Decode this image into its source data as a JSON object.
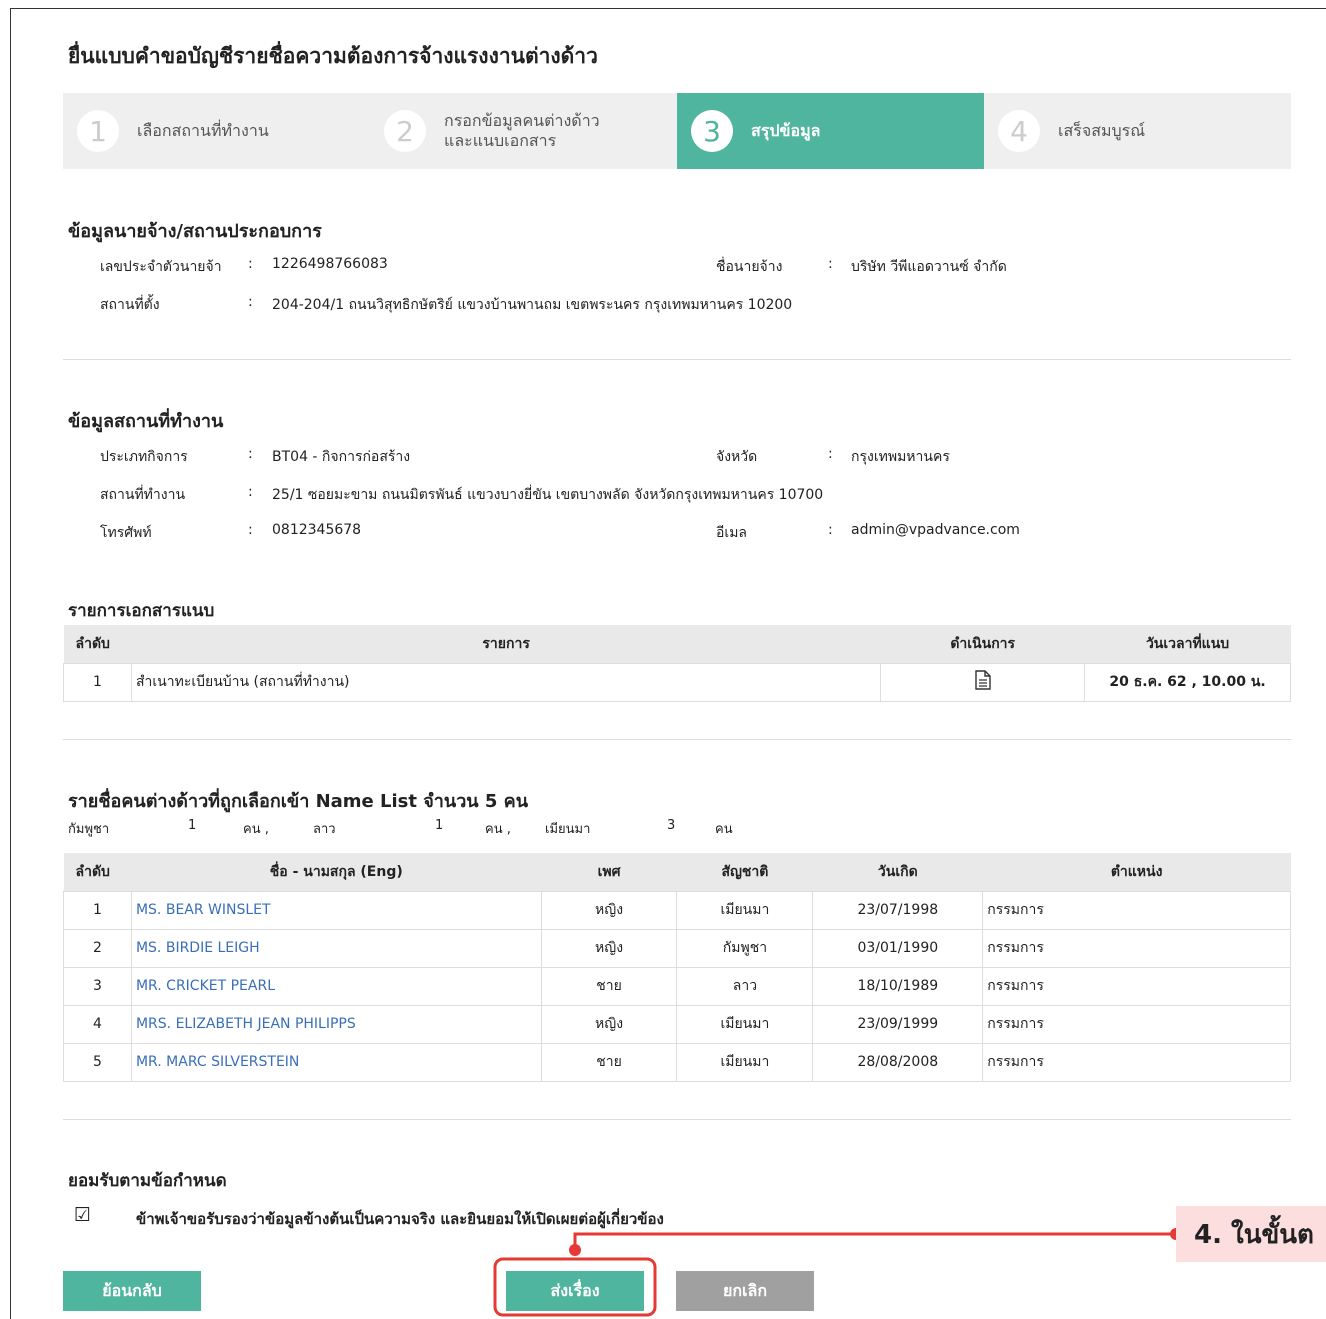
{
  "page_title": "ยื่นแบบคำขอบัญชีรายชื่อความต้องการจ้างแรงงานต่างด้าว",
  "steps": [
    {
      "num": "1",
      "label": "เลือกสถานที่ทำงาน"
    },
    {
      "num": "2",
      "label": "กรอกข้อมูลคนต่างด้าว\nและแนบเอกสาร"
    },
    {
      "num": "3",
      "label": "สรุปข้อมูล"
    },
    {
      "num": "4",
      "label": "เสร็จสมบูรณ์"
    }
  ],
  "employer": {
    "title": "ข้อมูลนายจ้าง/สถานประกอบการ",
    "id_label": "เลขประจำตัวนายจ้า",
    "id_value": "1226498766083",
    "name_label": "ชื่อนายจ้าง",
    "name_value": "บริษัท วีพีแอดวานซ์ จำกัด",
    "address_label": "สถานที่ตั้ง",
    "address_value": "204-204/1 ถนนวิสุทธิกษัตริย์ แขวงบ้านพานถม เขตพระนคร กรุงเทพมหานคร 10200"
  },
  "workplace": {
    "title": "ข้อมูลสถานที่ทำงาน",
    "business_label": "ประเภทกิจการ",
    "business_value": "BT04 - กิจการก่อสร้าง",
    "province_label": "จังหวัด",
    "province_value": "กรุงเทพมหานคร",
    "place_label": "สถานที่ทำงาน",
    "place_value": "25/1 ซอยมะขาม ถนนมิตรพันธ์ แขวงบางยี่ขัน เขตบางพลัด จังหวัดกรุงเทพมหานคร 10700",
    "phone_label": "โทรศัพท์",
    "phone_value": "0812345678",
    "email_label": "อีเมล",
    "email_value": "admin@vpadvance.com"
  },
  "colon": ":",
  "documents": {
    "title": "รายการเอกสารแนบ",
    "headers": [
      "ลำดับ",
      "รายการ",
      "ดำเนินการ",
      "วันเวลาที่แนบ"
    ],
    "rows": [
      {
        "no": "1",
        "name": "สำเนาทะเบียนบ้าน (สถานที่ทำงาน)",
        "date": "20 ธ.ค. 62 , 10.00 น."
      }
    ],
    "action_icon": "document-icon"
  },
  "namelist": {
    "title": "รายชื่อคนต่างด้าวที่ถูกเลือกเข้า Name List จำนวน 5 คน",
    "counts": [
      "กัมพูชา",
      "1",
      "คน ,",
      "ลาว",
      "1",
      "คน ,",
      "เมียนมา",
      "3",
      "คน"
    ],
    "headers": [
      "ลำดับ",
      "ชื่อ - นามสกุล (Eng)",
      "เพศ",
      "สัญชาติ",
      "วันเกิด",
      "ตำแหน่ง"
    ],
    "rows": [
      {
        "no": "1",
        "name": "MS. BEAR WINSLET",
        "sex": "หญิง",
        "nat": "เมียนมา",
        "dob": "23/07/1998",
        "pos": "กรรมการ"
      },
      {
        "no": "2",
        "name": "MS. BIRDIE LEIGH",
        "sex": "หญิง",
        "nat": "กัมพูชา",
        "dob": "03/01/1990",
        "pos": "กรรมการ"
      },
      {
        "no": "3",
        "name": "MR. CRICKET PEARL",
        "sex": "ชาย",
        "nat": "ลาว",
        "dob": "18/10/1989",
        "pos": "กรรมการ"
      },
      {
        "no": "4",
        "name": "MRS. ELIZABETH JEAN PHILIPPS",
        "sex": "หญิง",
        "nat": "เมียนมา",
        "dob": "23/09/1999",
        "pos": "กรรมการ"
      },
      {
        "no": "5",
        "name": "MR. MARC SILVERSTEIN",
        "sex": "ชาย",
        "nat": "เมียนมา",
        "dob": "28/08/2008",
        "pos": "กรรมการ"
      }
    ]
  },
  "terms": {
    "title": "ยอมรับตามข้อกำหนด",
    "checkbox": "☑",
    "text": "ข้าพเจ้าขอรับรองว่าข้อมูลข้างต้นเป็นความจริง และยินยอมให้เปิดเผยต่อผู้เกี่ยวข้อง"
  },
  "buttons": {
    "back": "ย้อนกลับ",
    "submit": "ส่งเรื่อง",
    "cancel": "ยกเลิก"
  },
  "callout": {
    "text": "4. ในขั้นต",
    "color": "#e53935",
    "bg": "#fcdede"
  },
  "colors": {
    "accent": "#4fb59e",
    "gray_button": "#a0a0a0",
    "link": "#3a6fb8"
  }
}
